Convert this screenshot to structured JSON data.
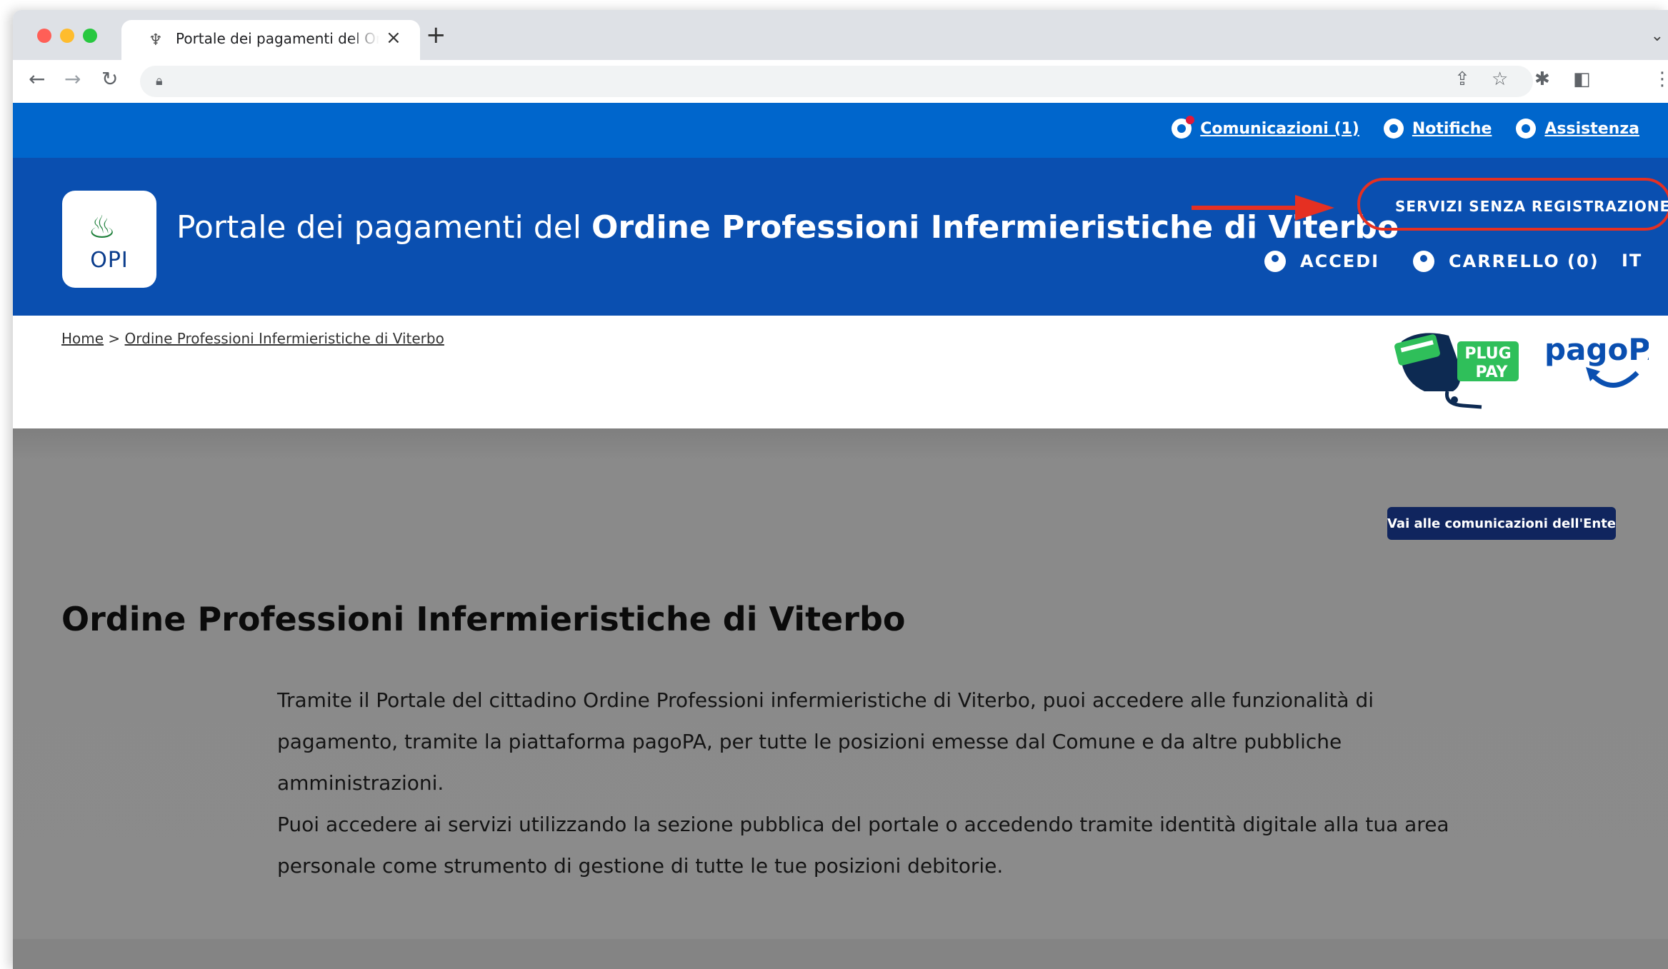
{
  "browser": {
    "tab_title": "Portale dei pagamenti del Ordine Professioni Infermieristiche di Viterbo",
    "tab_close": "×",
    "new_tab": "+"
  },
  "utility_bar": {
    "comunicazioni": "Comunicazioni (1)",
    "notifiche": "Notifiche",
    "assistenza": "Assistenza"
  },
  "header": {
    "logo_text": "OPI",
    "title_prefix": "Portale dei pagamenti del ",
    "title_bold": "Ordine Professioni Infermieristiche di Viterbo",
    "servizi": "SERVIZI SENZA REGISTRAZIONE",
    "accedi": "ACCEDI",
    "carrello": "CARRELLO (0)",
    "lang": "IT"
  },
  "breadcrumb": {
    "home": "Home",
    "separator": " > ",
    "current": "Ordine Professioni Infermieristiche di Viterbo"
  },
  "logos": {
    "plugpay_line1": "PLUG",
    "plugpay_line2": "PAY",
    "pagopa": "pagoPA"
  },
  "main": {
    "comunicazioni_button": "Vai alle comunicazioni dell'Ente",
    "title": "Ordine Professioni Infermieristiche di Viterbo",
    "paragraph1": "Tramite il Portale del cittadino Ordine Professioni infermieristiche di Viterbo, puoi accedere alle funzionalità di pagamento, tramite la piattaforma pagoPA, per tutte le posizioni emesse dal Comune e da altre pubbliche amministrazioni.",
    "paragraph2": "Puoi accedere ai servizi utilizzando la sezione pubblica del portale o accedendo tramite identità digitale alla tua area personale come strumento di gestione di tutte le tue posizioni debitorie."
  },
  "colors": {
    "utility_blue": "#0066cc",
    "header_blue": "#0a4fb0",
    "highlight_red": "#e53022",
    "button_navy": "#10255e"
  }
}
